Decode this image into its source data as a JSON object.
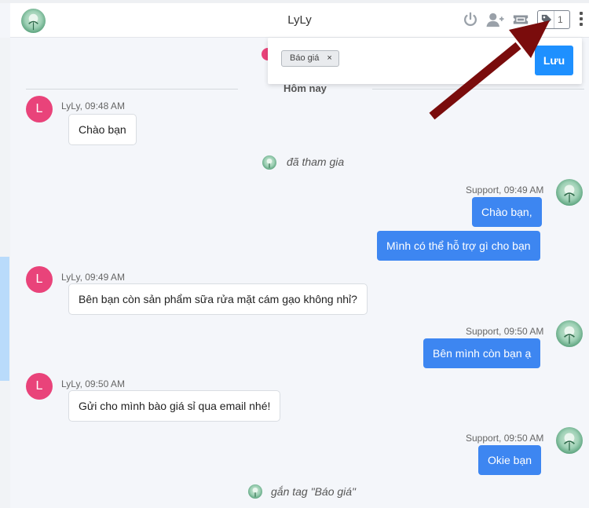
{
  "header": {
    "title": "LyLy",
    "tag_count": "1"
  },
  "tag_popup": {
    "tag": "Báo giá",
    "remove": "×",
    "save_label": "Lưu"
  },
  "day_separator": "Hôm nay",
  "messages": [
    {
      "meta": "LyLy, 09:48 AM",
      "avatar": "L",
      "text": "Chào bạn"
    },
    {
      "system": "đã tham gia"
    },
    {
      "meta": "Support, 09:49 AM",
      "texts": [
        "Chào bạn,",
        "Mình có thể hỗ trợ gì cho bạn"
      ]
    },
    {
      "meta": "LyLy, 09:49 AM",
      "avatar": "L",
      "text": "Bên bạn còn sản phẩm sữa rửa mặt cám gạo không nhỉ?"
    },
    {
      "meta": "Support, 09:50 AM",
      "text": "Bên mình còn bạn ạ"
    },
    {
      "meta": "LyLy, 09:50 AM",
      "avatar": "L",
      "text": "Gửi cho mình bào giá sỉ qua email nhé!"
    },
    {
      "meta": "Support, 09:50 AM",
      "text": "Okie bạn"
    },
    {
      "system": "gắn tag \"Báo giá\""
    }
  ],
  "colors": {
    "accent": "#1e90ff",
    "outgoing_bubble": "#3d86f1",
    "customer_avatar": "#e9437a",
    "annotation_arrow": "#7a0c0c"
  },
  "icons": {
    "header": [
      "power-icon",
      "add-user-icon",
      "ticket-icon",
      "tag-icon",
      "more-vertical-icon"
    ]
  }
}
